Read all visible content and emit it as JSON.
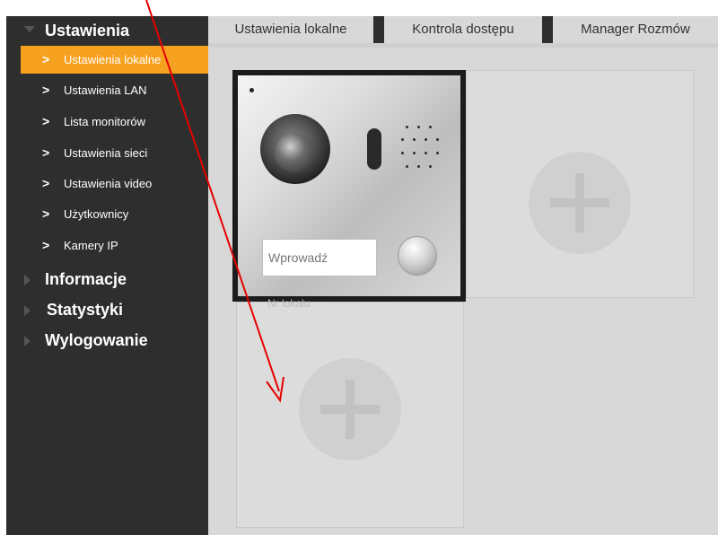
{
  "sidebar": {
    "groups": [
      {
        "label": "Ustawienia",
        "expanded": true
      },
      {
        "label": "Informacje",
        "expanded": false
      },
      {
        "label": "Statystyki",
        "expanded": false
      },
      {
        "label": "Wylogowanie",
        "expanded": false
      }
    ],
    "sub_items": [
      {
        "label": "Ustawienia lokalne",
        "active": true
      },
      {
        "label": "Ustawienia LAN",
        "active": false
      },
      {
        "label": "Lista monitorów",
        "active": false
      },
      {
        "label": "Ustawienia sieci",
        "active": false
      },
      {
        "label": "Ustawienia video",
        "active": false
      },
      {
        "label": "Użytkownicy",
        "active": false
      },
      {
        "label": "Kamery IP",
        "active": false
      }
    ]
  },
  "tabs": [
    {
      "label": "Ustawienia lokalne",
      "active": true
    },
    {
      "label": "Kontrola dostępu",
      "active": false
    },
    {
      "label": "Manager Rozmów",
      "active": false
    }
  ],
  "device": {
    "input_placeholder": "Wprowadź",
    "flat_label": "Nr lokalu"
  },
  "icons": {
    "add": "plus-icon",
    "chevron": "chevron-right-icon",
    "expand": "triangle-down-icon",
    "collapse": "triangle-right-icon",
    "annotation": "red-arrow"
  },
  "colors": {
    "sidebar_bg": "#2e2e2e",
    "active_item": "#f7a120",
    "content_bg": "#d8d8d8",
    "arrow": "#e60000"
  }
}
